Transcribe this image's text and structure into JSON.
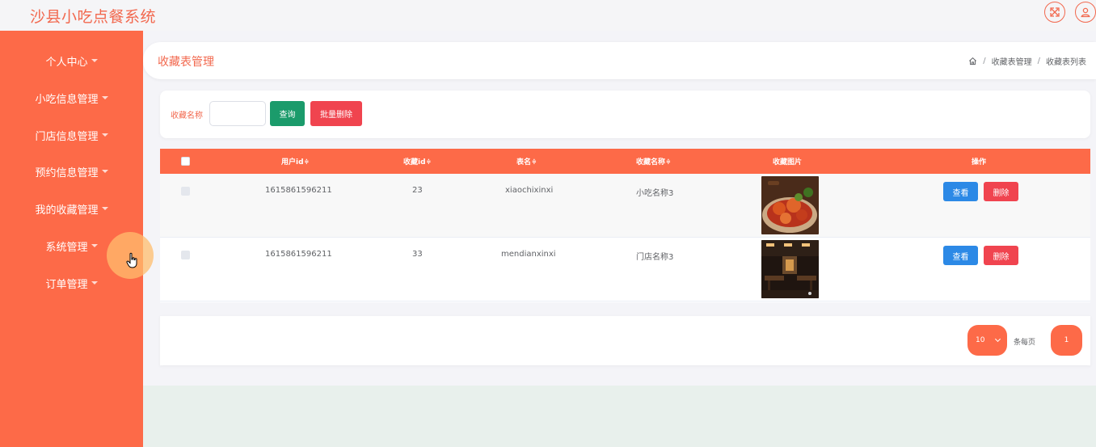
{
  "app": {
    "title": "沙县小吃点餐系统"
  },
  "topbar": {
    "icons": [
      "fullscreen-icon",
      "user-icon"
    ]
  },
  "colors": {
    "accent": "#fd6a48",
    "title": "#f2684e",
    "query": "#1b9b6b",
    "danger": "#f0444f",
    "view": "#2c89e6"
  },
  "sidebar": {
    "items": [
      {
        "label": "个人中心"
      },
      {
        "label": "小吃信息管理"
      },
      {
        "label": "门店信息管理"
      },
      {
        "label": "预约信息管理"
      },
      {
        "label": "我的收藏管理"
      },
      {
        "label": "系统管理"
      },
      {
        "label": "订单管理"
      }
    ]
  },
  "header": {
    "title": "收藏表管理",
    "breadcrumb": [
      "收藏表管理",
      "收藏表列表"
    ],
    "separator": "/"
  },
  "search": {
    "label": "收藏名称",
    "value": "",
    "placeholder": "",
    "query_label": "查询",
    "batch_delete_label": "批量删除"
  },
  "table": {
    "columns": [
      "用户id",
      "收藏id",
      "表名",
      "收藏名称",
      "收藏图片",
      "操作"
    ],
    "sort_glyph": "≑",
    "rows": [
      {
        "user_id": "1615861596211",
        "fav_id": "23",
        "table_name": "xiaochixinxi",
        "fav_name": "小吃名称3",
        "image": "spicy-crayfish-dish",
        "view_label": "查看",
        "delete_label": "删除"
      },
      {
        "user_id": "1615861596211",
        "fav_id": "33",
        "table_name": "mendianxinxi",
        "fav_name": "门店名称3",
        "image": "restaurant-interior",
        "view_label": "查看",
        "delete_label": "删除"
      }
    ]
  },
  "pagination": {
    "page_size": "10",
    "per_page_label": "条每页",
    "current_page": "1"
  }
}
